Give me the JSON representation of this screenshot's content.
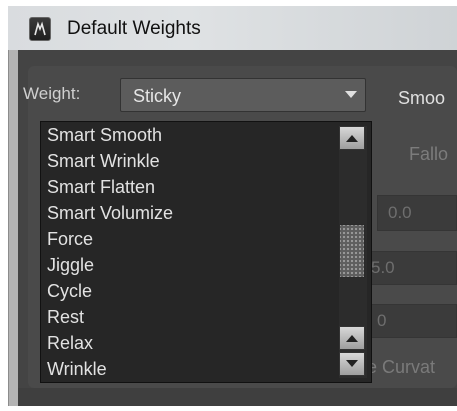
{
  "window": {
    "title": "Default Weights",
    "icon": "maya-app-icon"
  },
  "weight": {
    "label": "Weight:",
    "selected": "Sticky"
  },
  "right_panel": {
    "smooth_label": "Smoo",
    "falloff_label": "Fallo",
    "field1_value": "0.0",
    "field2_value": "5.0",
    "field3_value": "0",
    "curvature_label": "e Curvat"
  },
  "dropdown": {
    "options": [
      "Smart Smooth",
      "Smart Wrinkle",
      "Smart Flatten",
      "Smart Volumize",
      "Force",
      "Jiggle",
      "Cycle",
      "Rest",
      "Relax",
      "Wrinkle"
    ]
  }
}
